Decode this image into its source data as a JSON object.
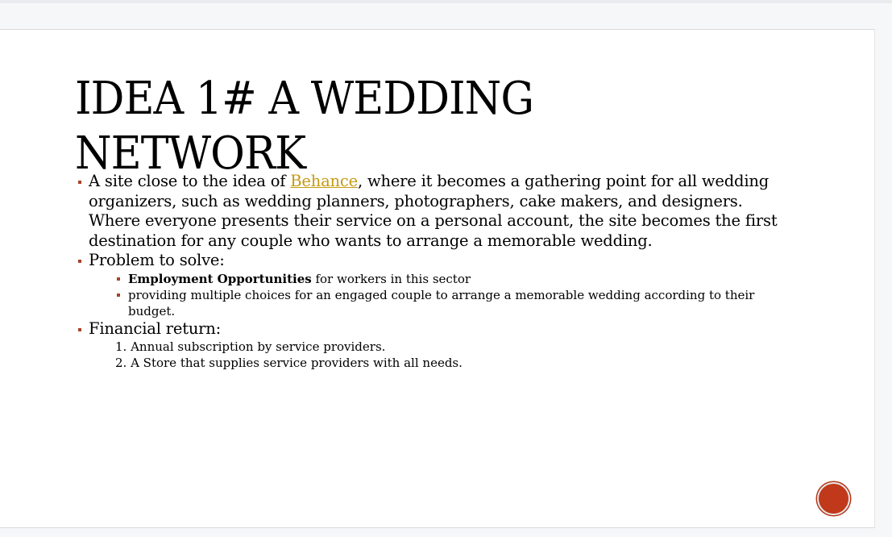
{
  "slide": {
    "title_line1": "IDEA 1# A WEDDING",
    "title_line2": "NETWORK",
    "bullet1": {
      "before": "A site close to the idea of ",
      "link": "Behance",
      "after": ", where it becomes a gathering point for all wedding organizers, such as wedding planners, photographers, cake makers, and designers. Where everyone presents their service on a personal account, the site becomes the first destination for any couple who wants to arrange a memorable wedding."
    },
    "bullet2": {
      "label": "Problem to solve:",
      "sub": [
        {
          "bold": "Employment Opportunities",
          "rest": " for workers in this sector"
        },
        {
          "bold": "",
          "rest": "providing multiple choices for an engaged couple to arrange a memorable wedding according to their budget."
        }
      ]
    },
    "bullet3": {
      "label": "Financial return:",
      "items": [
        "1. Annual subscription by service providers.",
        "2. A Store that supplies service providers with all needs."
      ]
    }
  },
  "colors": {
    "bullet_marker": "#a5442a",
    "link": "#c49a14",
    "action_button": "#c0391b"
  },
  "icons": {
    "action_button": "circle-button-icon"
  }
}
